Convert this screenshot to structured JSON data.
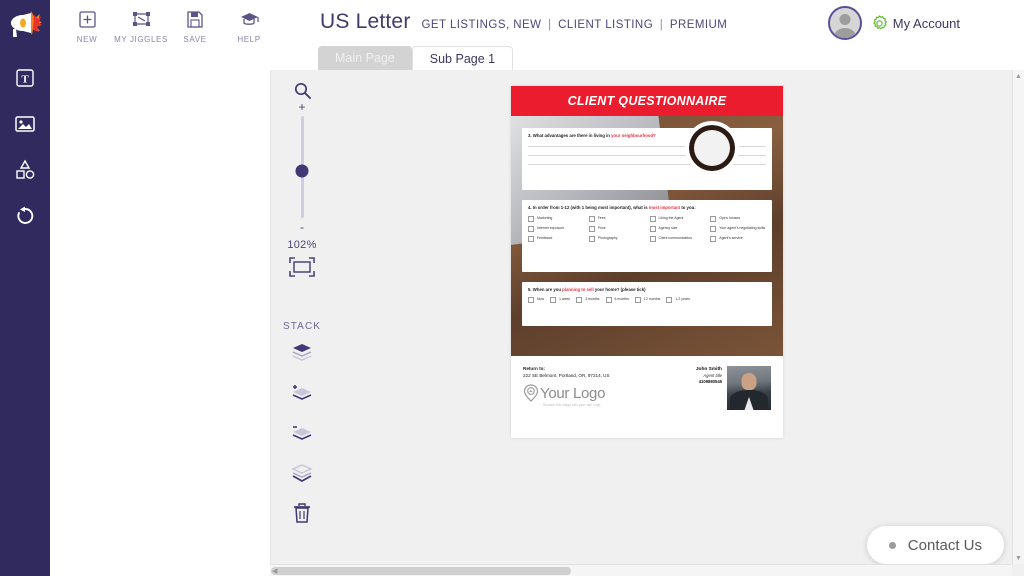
{
  "brand": {
    "logo_name": "megaphone-logo"
  },
  "toolbar": {
    "items": [
      {
        "label": "NEW",
        "icon": "plus-square-icon"
      },
      {
        "label": "MY JIGGLES",
        "icon": "transform-icon"
      },
      {
        "label": "SAVE",
        "icon": "floppy-disk-icon"
      },
      {
        "label": "HELP",
        "icon": "graduation-cap-icon"
      }
    ]
  },
  "header": {
    "title": "US Letter",
    "breadcrumbs": [
      "GET LISTINGS, NEW",
      "CLIENT LISTING",
      "PREMIUM"
    ],
    "separator": "|",
    "account_label": "My Account"
  },
  "tabs": [
    {
      "label": "Main Page",
      "active": false
    },
    {
      "label": "Sub Page 1",
      "active": true
    }
  ],
  "left_rail": {
    "tools": [
      {
        "name": "text-tool",
        "icon": "text-box-icon"
      },
      {
        "name": "image-tool",
        "icon": "image-icon"
      },
      {
        "name": "shapes-tool",
        "icon": "shapes-icon"
      },
      {
        "name": "undo-tool",
        "icon": "undo-arrow-icon"
      }
    ]
  },
  "zoom_panel": {
    "magnifier_icon": "search-icon",
    "plus": "+",
    "minus": "-",
    "zoom_level": "102%",
    "fit_icon": "fit-to-screen-icon",
    "stack_label": "STACK",
    "stack_buttons": [
      {
        "name": "bring-to-front-button",
        "icon": "layers-top-icon"
      },
      {
        "name": "bring-forward-button",
        "icon": "layers-up-icon"
      },
      {
        "name": "send-backward-button",
        "icon": "layers-down-icon"
      },
      {
        "name": "send-to-back-button",
        "icon": "layers-bottom-icon"
      },
      {
        "name": "delete-button",
        "icon": "trash-icon"
      }
    ]
  },
  "document": {
    "banner_title": "CLIENT QUESTIONNAIRE",
    "banner_color": "#ea1c2d",
    "questions": [
      {
        "number": "3.",
        "text_before": "What advantages are there in living in ",
        "highlight": "your neighbourhood?",
        "text_after": "",
        "lines": 3
      },
      {
        "number": "4.",
        "text_before": "In order from 1-12 (with 1 being most important), what is ",
        "highlight": "most important",
        "text_after": " to you:",
        "options": [
          "Marketing",
          "Fees",
          "Liking the Agent",
          "Open houses",
          "Internet exposure",
          "Price",
          "Agency size",
          "Your agent's negotiating skills",
          "Feedback",
          "Photography",
          "Client communication",
          "Agent's service"
        ]
      },
      {
        "number": "5.",
        "text_before": "When are you ",
        "highlight": "planning to sell",
        "text_after": " your home? (please tick)",
        "options": [
          "Now",
          "1 week",
          "3 months",
          "6 months",
          "12 months",
          "1-2 years"
        ]
      }
    ],
    "footer": {
      "return_label": "Return to:",
      "return_address": "222 SE Belmont, Portland, OR, 97214, US",
      "logo_text": "Your Logo",
      "logo_sub": "Replace this image with your own Logo.",
      "agent_name": "John Smith",
      "agent_role": "Agent title",
      "agent_phone": "4109880545"
    }
  },
  "contact_widget": {
    "label": "Contact Us"
  }
}
